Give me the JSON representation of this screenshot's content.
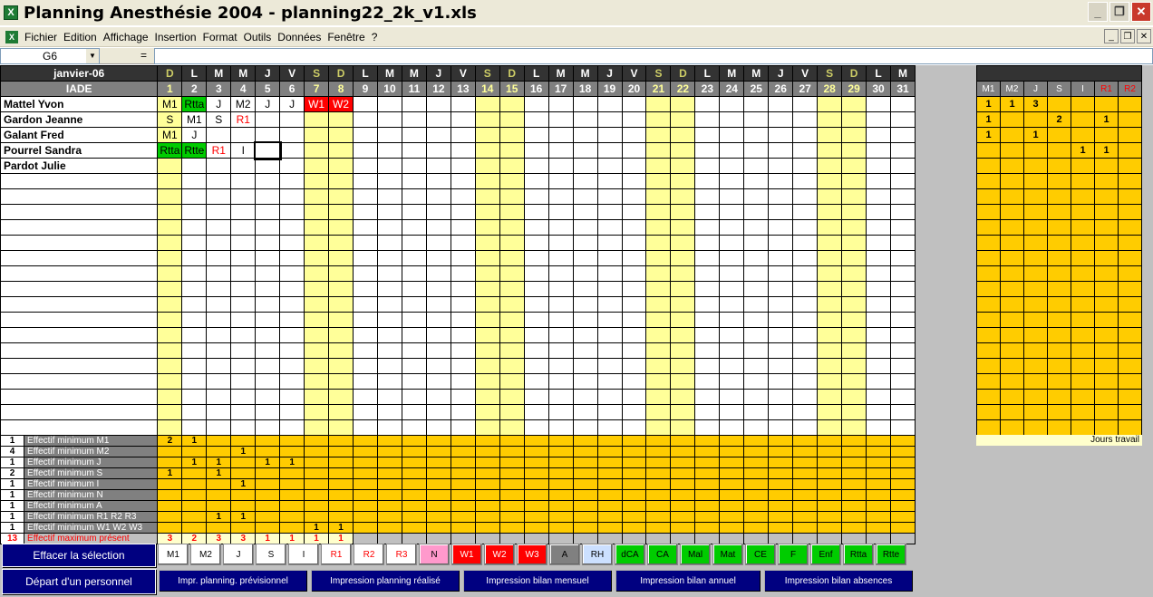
{
  "window": {
    "title": "Planning Anesthésie 2004 - planning22_2k_v1.xls"
  },
  "menu": {
    "items": [
      "Fichier",
      "Edition",
      "Affichage",
      "Insertion",
      "Format",
      "Outils",
      "Données",
      "Fenêtre",
      "?"
    ]
  },
  "formula": {
    "cell": "G6",
    "eq": "=",
    "content": ""
  },
  "planning": {
    "month": "janvier-06",
    "section": "IADE",
    "day_letters": [
      "D",
      "L",
      "M",
      "M",
      "J",
      "V",
      "S",
      "D",
      "L",
      "M",
      "M",
      "J",
      "V",
      "S",
      "D",
      "L",
      "M",
      "M",
      "J",
      "V",
      "S",
      "D",
      "L",
      "M",
      "M",
      "J",
      "V",
      "S",
      "D",
      "L",
      "M"
    ],
    "day_numbers": [
      "1",
      "2",
      "3",
      "4",
      "5",
      "6",
      "7",
      "8",
      "9",
      "10",
      "11",
      "12",
      "13",
      "14",
      "15",
      "16",
      "17",
      "18",
      "19",
      "20",
      "21",
      "22",
      "23",
      "24",
      "25",
      "26",
      "27",
      "28",
      "29",
      "30",
      "31"
    ],
    "weekend_days": [
      1,
      7,
      8,
      14,
      15,
      21,
      22,
      28,
      29
    ],
    "staff": [
      {
        "name": "Mattel Yvon",
        "cells": {
          "1": "M1",
          "2": "Rtta",
          "3": "J",
          "4": "M2",
          "5": "J",
          "6": "J",
          "7": "W1",
          "8": "W2"
        }
      },
      {
        "name": "Gardon Jeanne",
        "cells": {
          "1": "S",
          "2": "M1",
          "3": "S",
          "4": "R1"
        }
      },
      {
        "name": "Galant Fred",
        "cells": {
          "1": "M1",
          "2": "J"
        }
      },
      {
        "name": "Pourrel Sandra",
        "cells": {
          "1": "Rtta",
          "2": "Rtte",
          "3": "R1",
          "4": "I"
        }
      },
      {
        "name": "Pardot Julie",
        "cells": {}
      }
    ],
    "empty_rows": 17
  },
  "effectifs": [
    {
      "num": "1",
      "label": "Effectif minimum M1",
      "values": {
        "1": "2",
        "2": "1"
      }
    },
    {
      "num": "4",
      "label": "Effectif minimum M2",
      "values": {
        "4": "1"
      }
    },
    {
      "num": "1",
      "label": "Effectif minimum J",
      "values": {
        "2": "1",
        "3": "1",
        "5": "1",
        "6": "1"
      }
    },
    {
      "num": "2",
      "label": "Effectif minimum S",
      "values": {
        "1": "1",
        "3": "1"
      }
    },
    {
      "num": "1",
      "label": "Effectif minimum I",
      "values": {
        "4": "1"
      }
    },
    {
      "num": "1",
      "label": "Effectif minimum N",
      "values": {}
    },
    {
      "num": "1",
      "label": "Effectif minimum A",
      "values": {}
    },
    {
      "num": "1",
      "label": "Effectif minimum R1 R2 R3",
      "values": {
        "3": "1",
        "4": "1"
      }
    },
    {
      "num": "1",
      "label": "Effectif minimum W1 W2 W3",
      "values": {
        "7": "1",
        "8": "1"
      }
    }
  ],
  "effectif_max": {
    "num": "13",
    "label": "Effectif maximum présent",
    "values": [
      "3",
      "2",
      "3",
      "3",
      "1",
      "1",
      "1",
      "1"
    ]
  },
  "summary": {
    "headers": [
      "M1",
      "M2",
      "J",
      "S",
      "I",
      "R1",
      "R2"
    ],
    "rows": [
      [
        "1",
        "1",
        "3",
        "",
        "",
        "",
        ""
      ],
      [
        "1",
        "",
        "",
        "2",
        "",
        "1",
        ""
      ],
      [
        "1",
        "",
        "1",
        "",
        "",
        "",
        ""
      ],
      [
        "",
        "",
        "",
        "",
        "1",
        "1",
        ""
      ]
    ],
    "footer": "Jours travail"
  },
  "code_buttons": [
    {
      "label": "M1",
      "bg": "#ffffff",
      "fg": "#000000"
    },
    {
      "label": "M2",
      "bg": "#ffffff",
      "fg": "#000000"
    },
    {
      "label": "J",
      "bg": "#ffffff",
      "fg": "#000000"
    },
    {
      "label": "S",
      "bg": "#ffffff",
      "fg": "#000000"
    },
    {
      "label": "I",
      "bg": "#ffffff",
      "fg": "#000000"
    },
    {
      "label": "R1",
      "bg": "#ffffff",
      "fg": "#ff0000"
    },
    {
      "label": "R2",
      "bg": "#ffffff",
      "fg": "#ff0000"
    },
    {
      "label": "R3",
      "bg": "#ffffff",
      "fg": "#ff0000"
    },
    {
      "label": "N",
      "bg": "#ff99cc",
      "fg": "#000000"
    },
    {
      "label": "W1",
      "bg": "#ff0000",
      "fg": "#ffffff"
    },
    {
      "label": "W2",
      "bg": "#ff0000",
      "fg": "#ffffff"
    },
    {
      "label": "W3",
      "bg": "#ff0000",
      "fg": "#ffffff"
    },
    {
      "label": "A",
      "bg": "#808080",
      "fg": "#000000"
    },
    {
      "label": "RH",
      "bg": "#cce0ff",
      "fg": "#000000"
    },
    {
      "label": "dCA",
      "bg": "#00cc00",
      "fg": "#000000"
    },
    {
      "label": "CA",
      "bg": "#00cc00",
      "fg": "#000000"
    },
    {
      "label": "Mal",
      "bg": "#00cc00",
      "fg": "#000000"
    },
    {
      "label": "Mat",
      "bg": "#00cc00",
      "fg": "#000000"
    },
    {
      "label": "CE",
      "bg": "#00cc00",
      "fg": "#000000"
    },
    {
      "label": "F",
      "bg": "#00cc00",
      "fg": "#000000"
    },
    {
      "label": "Enf",
      "bg": "#00cc00",
      "fg": "#000000"
    },
    {
      "label": "Rtta",
      "bg": "#00cc00",
      "fg": "#000000"
    },
    {
      "label": "Rtte",
      "bg": "#00cc00",
      "fg": "#000000"
    }
  ],
  "actions": {
    "clear": "Effacer la sélection",
    "depart": "Départ d'un personnel",
    "print_buttons": [
      "Impr. planning. prévisionnel",
      "Impression planning réalisé",
      "Impression bilan mensuel",
      "Impression bilan annuel",
      "Impression bilan absences"
    ]
  },
  "colors": {
    "weekend": "#ffff99",
    "weekend_header": "#cccc66",
    "orange": "#ffcc00",
    "navy": "#000080"
  }
}
